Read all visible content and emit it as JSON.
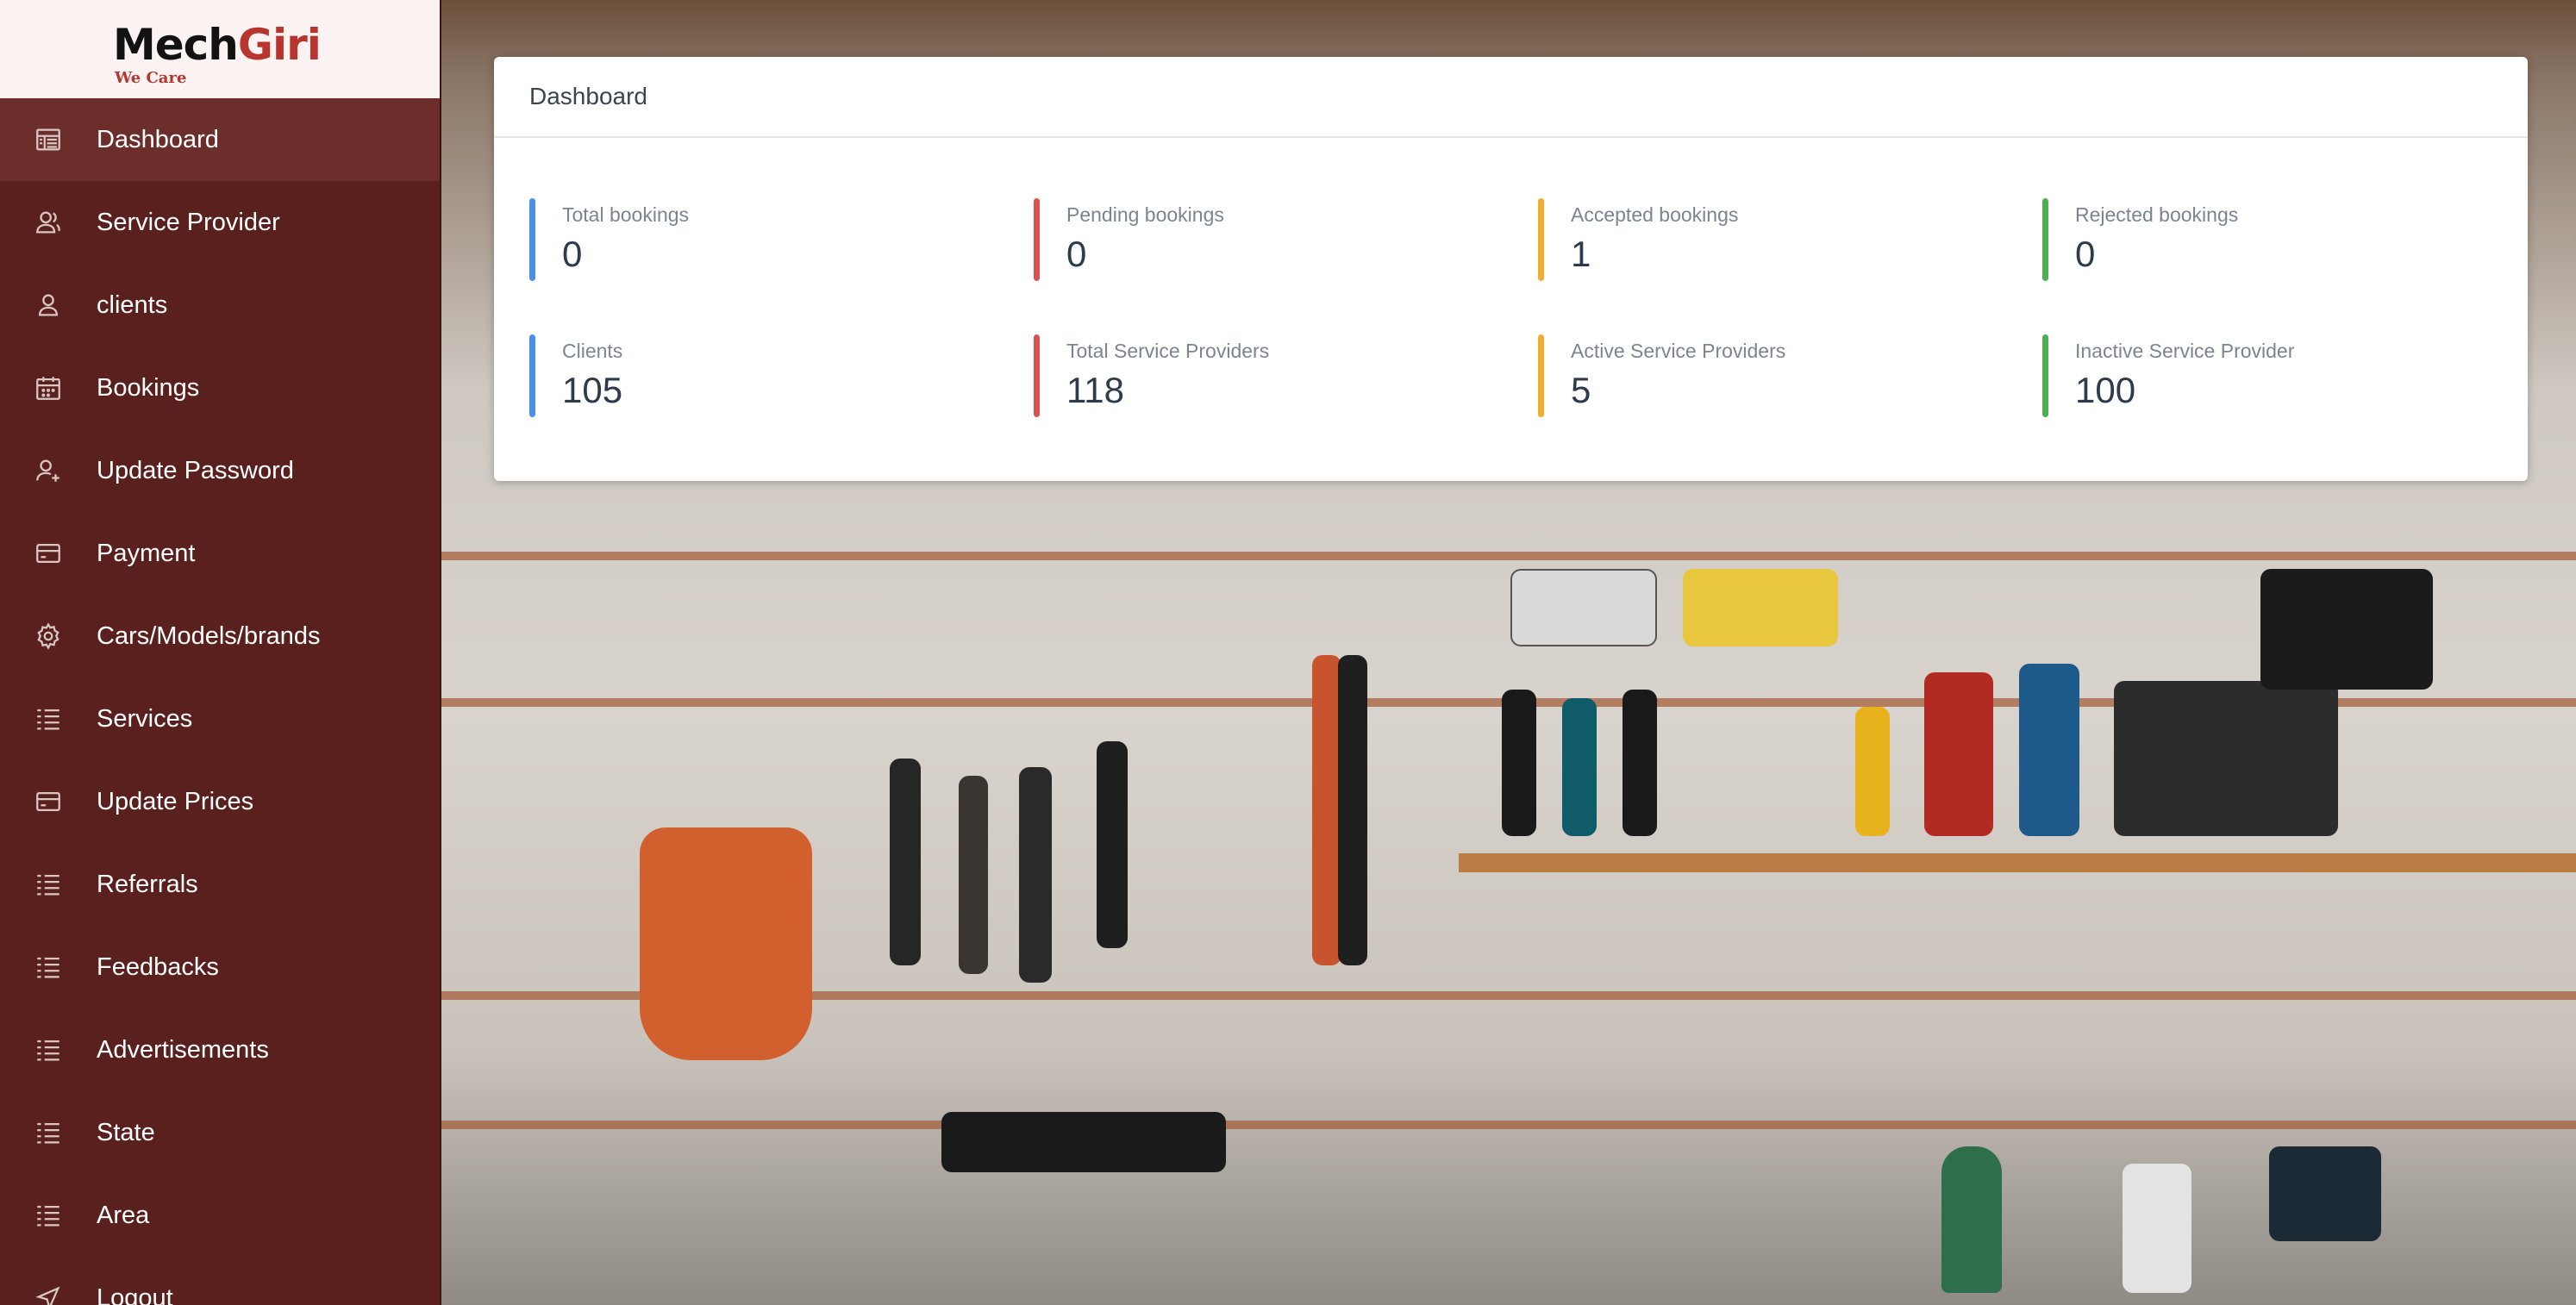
{
  "brand": {
    "name_part1": "Mech",
    "name_part2": "Giri",
    "tagline": "We Care"
  },
  "sidebar": {
    "items": [
      {
        "label": "Dashboard",
        "icon": "dashboard-icon",
        "active": true
      },
      {
        "label": "Service Provider",
        "icon": "users-icon"
      },
      {
        "label": "clients",
        "icon": "user-icon"
      },
      {
        "label": "Bookings",
        "icon": "calendar-icon"
      },
      {
        "label": "Update Password",
        "icon": "user-plus-icon"
      },
      {
        "label": "Payment",
        "icon": "credit-card-icon"
      },
      {
        "label": "Cars/Models/brands",
        "icon": "gear-icon"
      },
      {
        "label": "Services",
        "icon": "list-icon"
      },
      {
        "label": "Update Prices",
        "icon": "credit-card-icon"
      },
      {
        "label": "Referrals",
        "icon": "list-icon"
      },
      {
        "label": "Feedbacks",
        "icon": "list-icon"
      },
      {
        "label": "Advertisements",
        "icon": "list-icon"
      },
      {
        "label": "State",
        "icon": "list-icon"
      },
      {
        "label": "Area",
        "icon": "list-icon"
      },
      {
        "label": "Logout",
        "icon": "logout-icon"
      }
    ]
  },
  "card": {
    "title": "Dashboard",
    "stats": [
      {
        "label": "Total bookings",
        "value": "0",
        "color": "#4a8fe6"
      },
      {
        "label": "Pending bookings",
        "value": "0",
        "color": "#d9534f"
      },
      {
        "label": "Accepted bookings",
        "value": "1",
        "color": "#f0ad2e"
      },
      {
        "label": "Rejected bookings",
        "value": "0",
        "color": "#4caf50"
      },
      {
        "label": "Clients",
        "value": "105",
        "color": "#4a8fe6"
      },
      {
        "label": "Total Service Providers",
        "value": "118",
        "color": "#d9534f"
      },
      {
        "label": "Active Service Providers",
        "value": "5",
        "color": "#f0ad2e"
      },
      {
        "label": "Inactive Service Provider",
        "value": "100",
        "color": "#4caf50"
      }
    ]
  },
  "colors": {
    "sidebar": "#5a201d",
    "sidebar_active": "#6b2e2a",
    "brand_accent": "#b8352f"
  }
}
